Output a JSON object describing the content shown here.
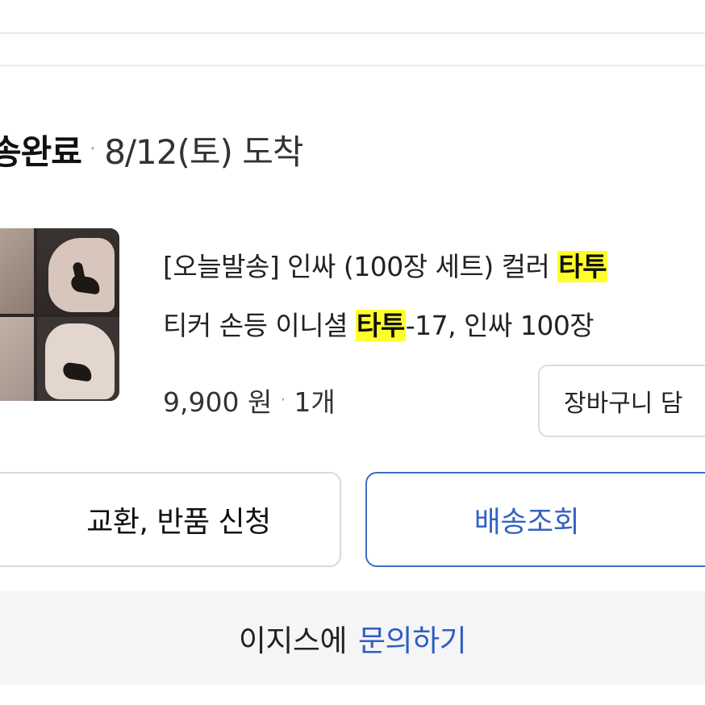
{
  "order": {
    "status": "송완료",
    "arrival": "8/12(토) 도착"
  },
  "product": {
    "title_line1_prefix": "[오늘발송] 인싸 (100장 세트) 컬러 ",
    "title_highlight": "타투",
    "title_line2_prefix": "티커 손등 이니셜 ",
    "title_line2_suffix": "-17, 인싸 100장 ",
    "price": "9,900 원",
    "quantity": "1개",
    "image_icon": "product-thumbnail"
  },
  "buttons": {
    "cart": "장바구니 담",
    "exchange_return": "교환, 반품 신청",
    "tracking": "배송조회"
  },
  "inquiry": {
    "prefix": "이지스에",
    "link": "문의하기"
  },
  "colors": {
    "highlight": "#ffff2a",
    "accent": "#3563c2",
    "inquiry_bg": "#f5f5f7"
  }
}
